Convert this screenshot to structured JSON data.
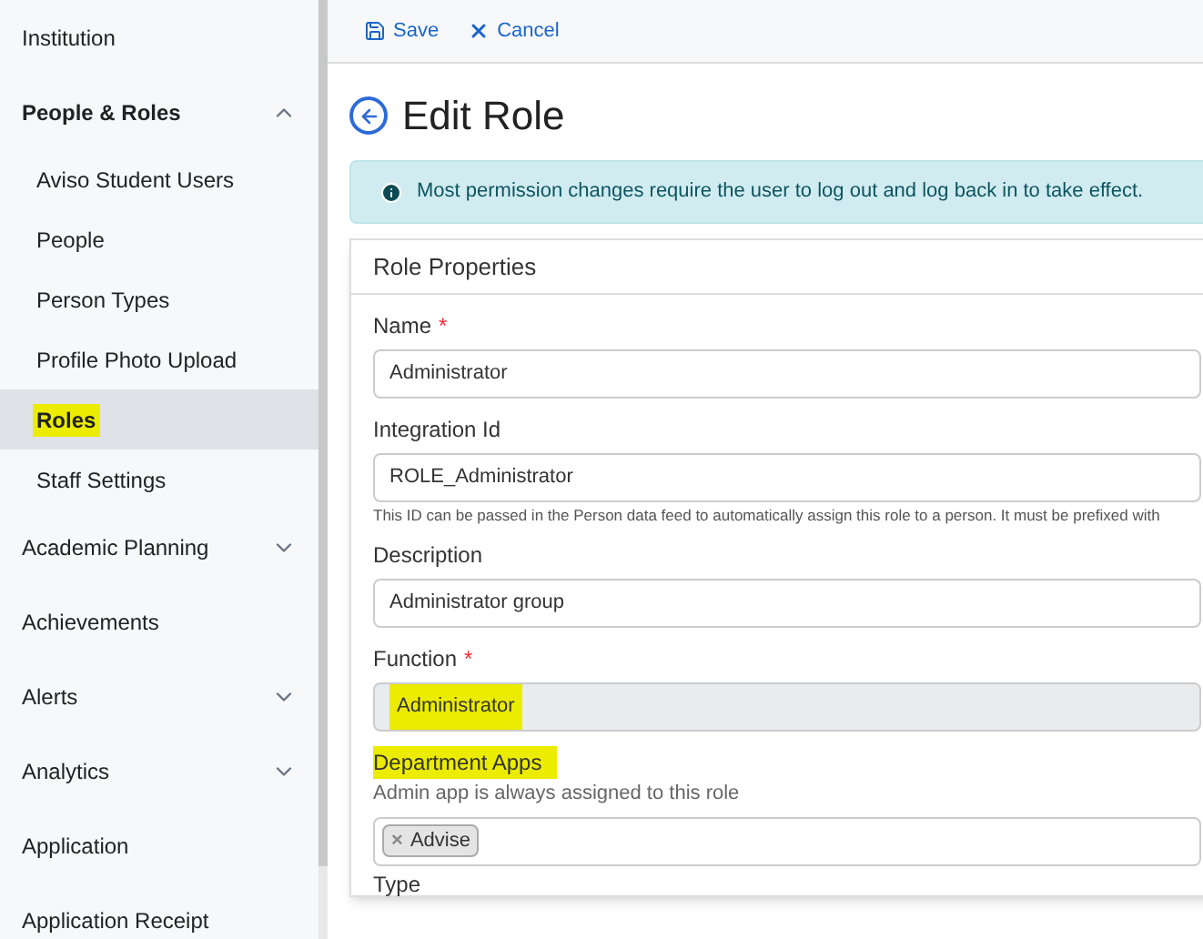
{
  "sidebar": {
    "items": [
      {
        "kind": "link",
        "label": "Institution"
      },
      {
        "kind": "group",
        "label": "People & Roles",
        "expanded": true,
        "children": [
          {
            "label": "Aviso Student Users",
            "selected": false,
            "highlighted": false
          },
          {
            "label": "People",
            "selected": false,
            "highlighted": false
          },
          {
            "label": "Person Types",
            "selected": false,
            "highlighted": false
          },
          {
            "label": "Profile Photo Upload",
            "selected": false,
            "highlighted": false
          },
          {
            "label": "Roles",
            "selected": true,
            "highlighted": true
          },
          {
            "label": "Staff Settings",
            "selected": false,
            "highlighted": false
          }
        ]
      },
      {
        "kind": "group",
        "label": "Academic Planning",
        "expanded": false
      },
      {
        "kind": "link",
        "label": "Achievements"
      },
      {
        "kind": "group",
        "label": "Alerts",
        "expanded": false
      },
      {
        "kind": "group",
        "label": "Analytics",
        "expanded": false
      },
      {
        "kind": "link",
        "label": "Application"
      },
      {
        "kind": "link",
        "label": "Application Receipt"
      }
    ]
  },
  "toolbar": {
    "buttons": [
      {
        "kind": "save",
        "label": "Save"
      },
      {
        "kind": "cancel",
        "label": "Cancel"
      }
    ]
  },
  "page_title": "Edit Role",
  "alert": "Most permission changes require the user to log out and log back in to take effect.",
  "card": {
    "title": "Role Properties",
    "fields": [
      {
        "kind": "text",
        "label": "Name",
        "required_mark": "*",
        "value": "Administrator",
        "highlighted": false,
        "disabled": false
      },
      {
        "kind": "text",
        "label": "Integration Id",
        "value": "ROLE_Administrator",
        "help": "This ID can be passed in the Person data feed to automatically assign this role to a person. It must be prefixed with",
        "highlighted": false,
        "disabled": false
      },
      {
        "kind": "text",
        "label": "Description",
        "value": "Administrator group",
        "highlighted": false,
        "disabled": false
      },
      {
        "kind": "text",
        "label": "Function",
        "required_mark": "*",
        "value": "Administrator",
        "highlighted": true,
        "disabled": true
      },
      {
        "kind": "tags",
        "label": "Department Apps",
        "label_highlighted": true,
        "note": "Admin app is always assigned to this role",
        "tags": [
          {
            "remove": "×",
            "label": "Advise"
          }
        ]
      },
      {
        "kind": "heading",
        "label": "Type"
      }
    ]
  }
}
